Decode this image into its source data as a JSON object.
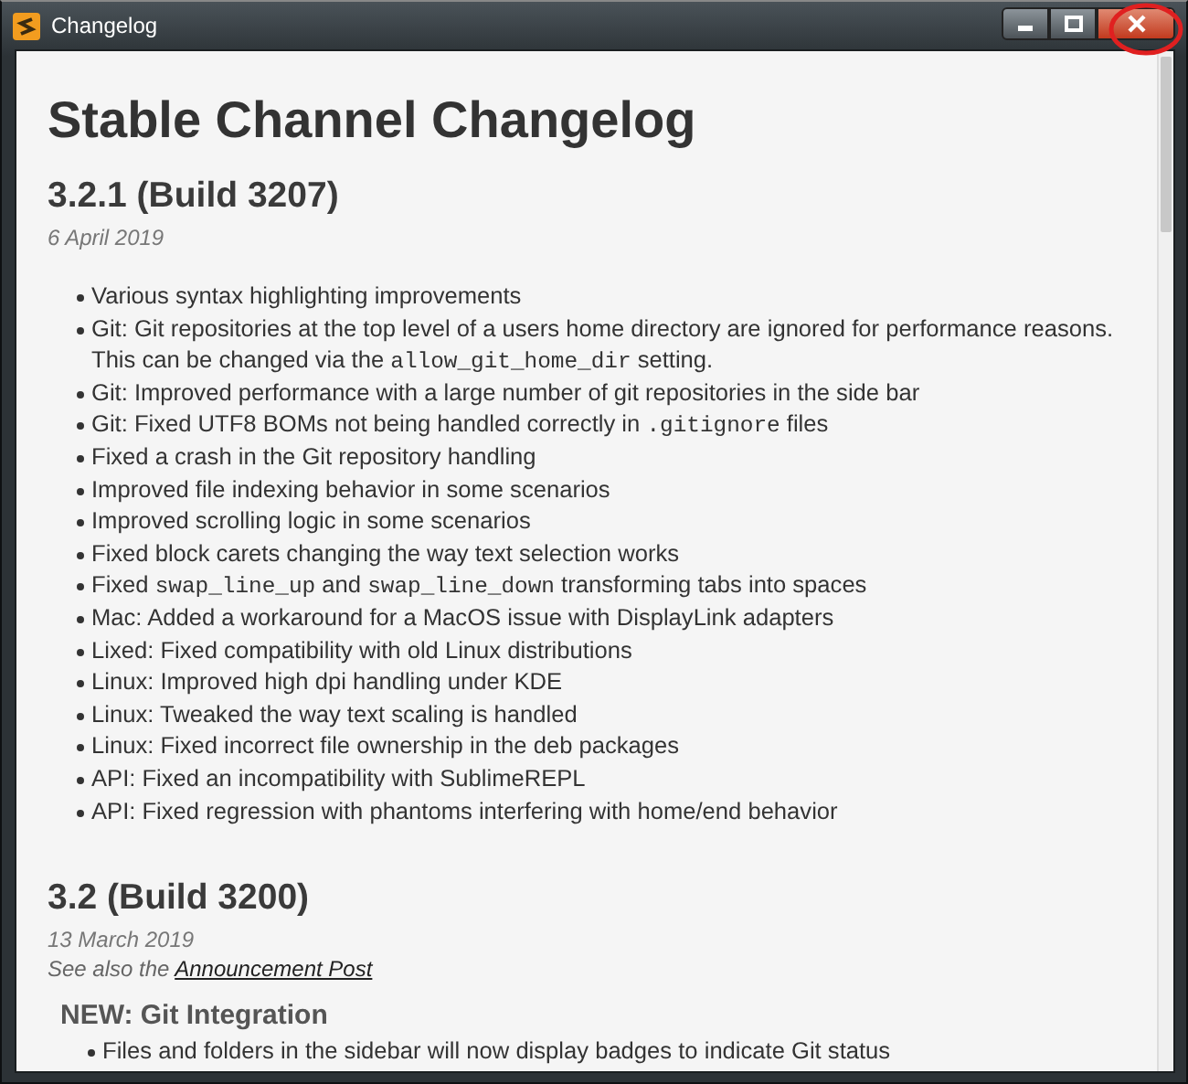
{
  "window": {
    "title": "Changelog",
    "controls": [
      {
        "kind": "minimize"
      },
      {
        "kind": "maximize"
      },
      {
        "kind": "close"
      }
    ]
  },
  "annotation": {
    "kind": "circle",
    "color": "#e02020"
  },
  "heading": "Stable Channel Changelog",
  "releases": [
    {
      "title": "3.2.1 (Build 3207)",
      "date": "6 April 2019",
      "items": [
        [
          {
            "text": "Various syntax highlighting improvements",
            "code": false
          }
        ],
        [
          {
            "text": "Git: Git repositories at the top level of a users home directory are ignored for performance reasons. This can be changed via the ",
            "code": false
          },
          {
            "text": "allow_git_home_dir",
            "code": true
          },
          {
            "text": " setting.",
            "code": false
          }
        ],
        [
          {
            "text": "Git: Improved performance with a large number of git repositories in the side bar",
            "code": false
          }
        ],
        [
          {
            "text": "Git: Fixed UTF8 BOMs not being handled correctly in ",
            "code": false
          },
          {
            "text": ".gitignore",
            "code": true
          },
          {
            "text": " files",
            "code": false
          }
        ],
        [
          {
            "text": "Fixed a crash in the Git repository handling",
            "code": false
          }
        ],
        [
          {
            "text": "Improved file indexing behavior in some scenarios",
            "code": false
          }
        ],
        [
          {
            "text": "Improved scrolling logic in some scenarios",
            "code": false
          }
        ],
        [
          {
            "text": "Fixed block carets changing the way text selection works",
            "code": false
          }
        ],
        [
          {
            "text": "Fixed ",
            "code": false
          },
          {
            "text": "swap_line_up",
            "code": true
          },
          {
            "text": " and ",
            "code": false
          },
          {
            "text": "swap_line_down",
            "code": true
          },
          {
            "text": " transforming tabs into spaces",
            "code": false
          }
        ],
        [
          {
            "text": "Mac: Added a workaround for a MacOS issue with DisplayLink adapters",
            "code": false
          }
        ],
        [
          {
            "text": "Lixed: Fixed compatibility with old Linux distributions",
            "code": false
          }
        ],
        [
          {
            "text": "Linux: Improved high dpi handling under KDE",
            "code": false
          }
        ],
        [
          {
            "text": "Linux: Tweaked the way text scaling is handled",
            "code": false
          }
        ],
        [
          {
            "text": "Linux: Fixed incorrect file ownership in the deb packages",
            "code": false
          }
        ],
        [
          {
            "text": "API: Fixed an incompatibility with SublimeREPL",
            "code": false
          }
        ],
        [
          {
            "text": "API: Fixed regression with phantoms interfering with home/end behavior",
            "code": false
          }
        ]
      ]
    },
    {
      "title": "3.2 (Build 3200)",
      "date": "13 March 2019",
      "see_also": {
        "text": "See also the ",
        "link": "Announcement Post"
      },
      "sections": [
        {
          "title": "NEW: Git Integration",
          "items": [
            [
              {
                "text": "Files and folders in the sidebar will now display badges to indicate Git status",
                "code": false
              }
            ]
          ]
        }
      ]
    }
  ]
}
